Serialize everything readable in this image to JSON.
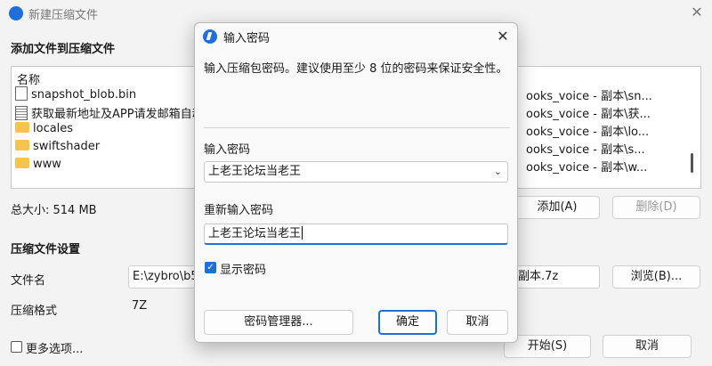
{
  "background_window": {
    "title": "新建压缩文件",
    "close_glyph": "✕",
    "add_section_title": "添加文件到压缩文件",
    "file_list": {
      "column_name": "名称",
      "items": [
        {
          "name": "snapshot_blob.bin",
          "icon": "document-icon",
          "path": "ooks_voice - 副本\\sn..."
        },
        {
          "name": "获取最新地址及APP请发邮箱自动",
          "icon": "text-document-icon",
          "path": "ooks_voice - 副本\\获..."
        },
        {
          "name": "locales",
          "icon": "folder-icon",
          "path": "ooks_voice - 副本\\lo..."
        },
        {
          "name": "swiftshader",
          "icon": "folder-icon",
          "path": "ooks_voice - 副本\\s..."
        },
        {
          "name": "www",
          "icon": "folder-icon",
          "path": "ooks_voice - 副本\\w..."
        }
      ]
    },
    "total_size": "总大小: 514 MB",
    "add_button": "添加(A)",
    "delete_button": "删除(D)",
    "settings_section_title": "压缩文件设置",
    "filename_label": "文件名",
    "filename_value": "E:\\zybro\\b5",
    "filename_tail": "副本.7z",
    "browse_button": "浏览(B)...",
    "format_label": "压缩格式",
    "format_value": "7Z",
    "more_options": "更多选项...",
    "start_button": "开始(S)",
    "cancel_button": "取消"
  },
  "dialog": {
    "title": "输入密码",
    "close_glyph": "✕",
    "description": "输入压缩包密码。建议使用至少 8 位的密码来保证安全性。",
    "password_label": "输入密码",
    "password_value": "上老王论坛当老王",
    "confirm_label": "重新输入密码",
    "confirm_value": "上老王论坛当老王",
    "show_password_label": "显示密码",
    "show_password_checked": true,
    "manager_button": "密码管理器...",
    "ok_button": "确定",
    "cancel_button": "取消"
  },
  "colors": {
    "accent": "#1e6fd9"
  }
}
